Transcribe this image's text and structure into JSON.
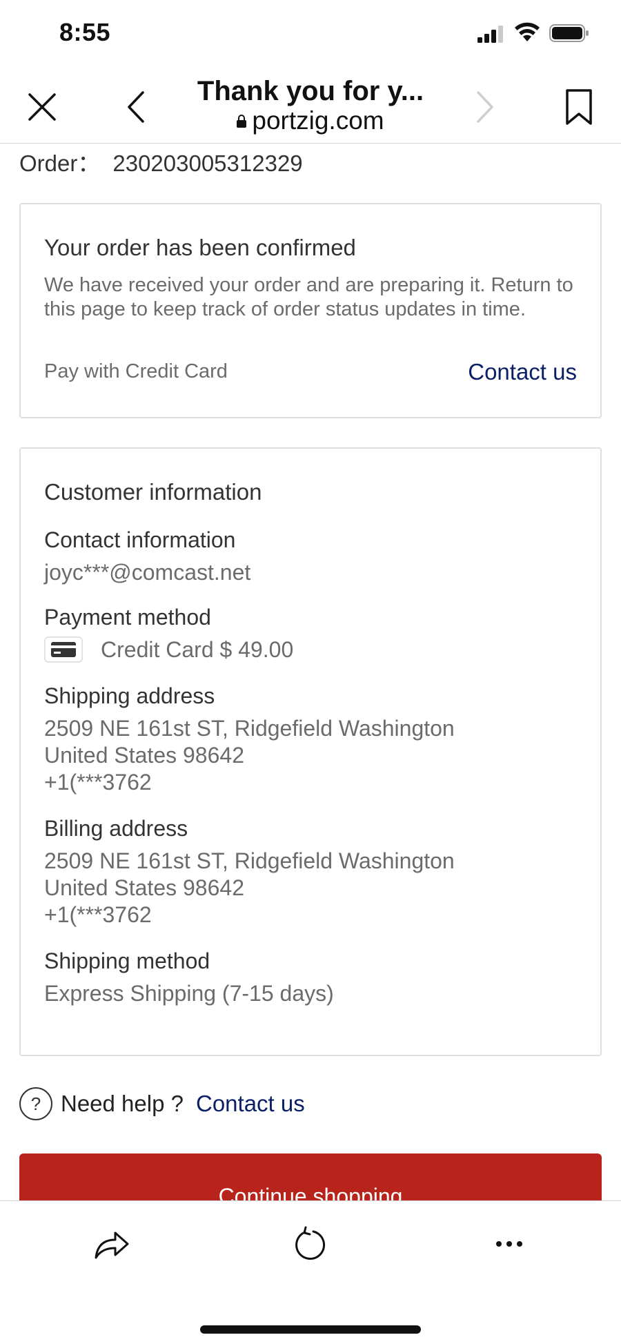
{
  "status_bar": {
    "time": "8:55"
  },
  "browser": {
    "title": "Thank you for y...",
    "url": "portzig.com"
  },
  "order": {
    "label": "Order：",
    "number": "230203005312329"
  },
  "confirmation": {
    "heading": "Your order has been confirmed",
    "description": "We have received your order and are preparing it. Return to this page to keep track of order status updates in time.",
    "pay_with": "Pay with Credit Card",
    "contact_link": "Contact us"
  },
  "customer": {
    "heading": "Customer information",
    "contact_label": "Contact information",
    "contact_value": "joyc***@comcast.net",
    "payment_label": "Payment method",
    "payment_value": "Credit Card $ 49.00",
    "shipping_label": "Shipping address",
    "shipping_line1": "2509 NE 161st ST, Ridgefield Washington",
    "shipping_line2": "United States 98642",
    "shipping_phone": "+1(***3762",
    "billing_label": "Billing address",
    "billing_line1": "2509 NE 161st ST, Ridgefield Washington",
    "billing_line2": "United States 98642",
    "billing_phone": "+1(***3762",
    "method_label": "Shipping method",
    "method_value": "Express Shipping (7-15 days)"
  },
  "help": {
    "text": "Need help ?",
    "link": "Contact us",
    "icon": "?"
  },
  "continue_button": "Continue shopping",
  "colors": {
    "accent_red": "#b8241c",
    "link_blue": "#0b1f66"
  }
}
